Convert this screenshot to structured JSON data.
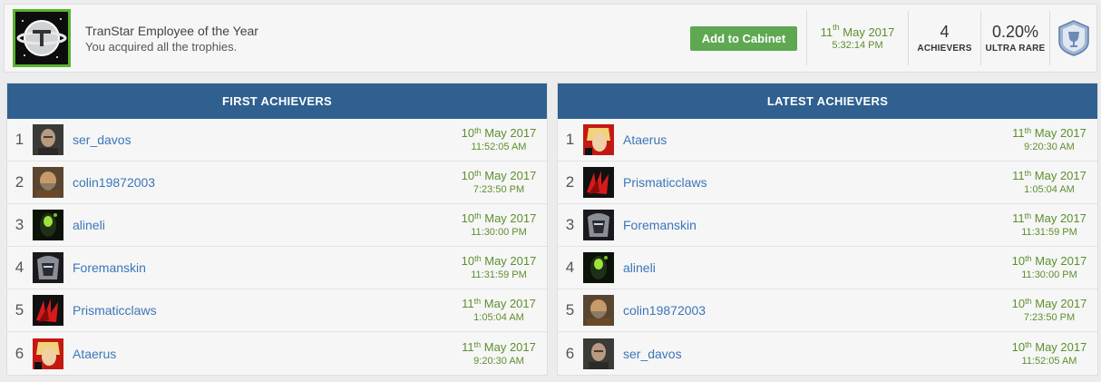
{
  "trophy": {
    "title": "TranStar Employee of the Year",
    "description": "You acquired all the trophies.",
    "add_button": "Add to Cabinet",
    "earned_day": "11",
    "earned_suffix": "th",
    "earned_month_year": " May 2017",
    "earned_time": "5:32:14 PM",
    "achievers_count": "4",
    "achievers_label": "ACHIEVERS",
    "rarity_value": "0.20%",
    "rarity_label": "ULTRA RARE",
    "grade_icon": "platinum-trophy-icon"
  },
  "colors": {
    "header": "#2f6090",
    "accent_green": "#5ea852",
    "date_green": "#5d8f2e",
    "link_blue": "#3b76b8"
  },
  "first_achievers": {
    "heading": "FIRST ACHIEVERS",
    "rows": [
      {
        "rank": "1",
        "name": "ser_davos",
        "day": "10",
        "suffix": "th",
        "my": " May 2017",
        "time": "11:52:05 AM",
        "avatar": "bald-man"
      },
      {
        "rank": "2",
        "name": "colin19872003",
        "day": "10",
        "suffix": "th",
        "my": " May 2017",
        "time": "7:23:50 PM",
        "avatar": "bearded-warrior"
      },
      {
        "rank": "3",
        "name": "alineli",
        "day": "10",
        "suffix": "th",
        "my": " May 2017",
        "time": "11:30:00 PM",
        "avatar": "alien-green"
      },
      {
        "rank": "4",
        "name": "Foremanskin",
        "day": "10",
        "suffix": "th",
        "my": " May 2017",
        "time": "11:31:59 PM",
        "avatar": "dark-helmet"
      },
      {
        "rank": "5",
        "name": "Prismaticclaws",
        "day": "11",
        "suffix": "th",
        "my": " May 2017",
        "time": "1:05:04 AM",
        "avatar": "red-claws"
      },
      {
        "rank": "6",
        "name": "Ataerus",
        "day": "11",
        "suffix": "th",
        "my": " May 2017",
        "time": "9:20:30 AM",
        "avatar": "comic-blonde"
      }
    ]
  },
  "latest_achievers": {
    "heading": "LATEST ACHIEVERS",
    "rows": [
      {
        "rank": "1",
        "name": "Ataerus",
        "day": "11",
        "suffix": "th",
        "my": " May 2017",
        "time": "9:20:30 AM",
        "avatar": "comic-blonde"
      },
      {
        "rank": "2",
        "name": "Prismaticclaws",
        "day": "11",
        "suffix": "th",
        "my": " May 2017",
        "time": "1:05:04 AM",
        "avatar": "red-claws"
      },
      {
        "rank": "3",
        "name": "Foremanskin",
        "day": "11",
        "suffix": "th",
        "my": " May 2017",
        "time": "11:31:59 PM",
        "avatar": "dark-helmet"
      },
      {
        "rank": "4",
        "name": "alineli",
        "day": "10",
        "suffix": "th",
        "my": " May 2017",
        "time": "11:30:00 PM",
        "avatar": "alien-green"
      },
      {
        "rank": "5",
        "name": "colin19872003",
        "day": "10",
        "suffix": "th",
        "my": " May 2017",
        "time": "7:23:50 PM",
        "avatar": "bearded-warrior"
      },
      {
        "rank": "6",
        "name": "ser_davos",
        "day": "10",
        "suffix": "th",
        "my": " May 2017",
        "time": "11:52:05 AM",
        "avatar": "bald-man"
      }
    ]
  }
}
